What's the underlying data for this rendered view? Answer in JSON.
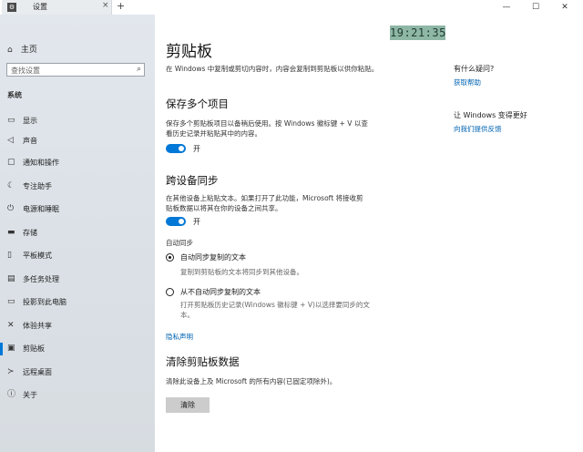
{
  "window": {
    "tab_title": "设置",
    "tab_icon": "settings-app-icon",
    "close_tab": "×",
    "new_tab": "+",
    "minimize": "—",
    "maximize": "☐",
    "close": "✕"
  },
  "clock": "19:21:35",
  "sidebar": {
    "home": "主页",
    "search_placeholder": "查找设置",
    "section": "系统",
    "items": [
      {
        "label": "显示",
        "icon": "display-icon"
      },
      {
        "label": "声音",
        "icon": "sound-icon"
      },
      {
        "label": "通知和操作",
        "icon": "notifications-icon"
      },
      {
        "label": "专注助手",
        "icon": "focus-assist-icon"
      },
      {
        "label": "电源和睡眠",
        "icon": "power-icon"
      },
      {
        "label": "存储",
        "icon": "storage-icon"
      },
      {
        "label": "平板模式",
        "icon": "tablet-mode-icon"
      },
      {
        "label": "多任务处理",
        "icon": "multitasking-icon"
      },
      {
        "label": "投影到此电脑",
        "icon": "project-icon"
      },
      {
        "label": "体验共享",
        "icon": "shared-experiences-icon"
      },
      {
        "label": "剪贴板",
        "icon": "clipboard-icon",
        "active": true
      },
      {
        "label": "远程桌面",
        "icon": "remote-desktop-icon"
      },
      {
        "label": "关于",
        "icon": "about-icon"
      }
    ]
  },
  "main": {
    "title": "剪贴板",
    "intro": "在 Windows 中复制或剪切内容时，内容会复制到剪贴板以供你粘贴。",
    "history": {
      "heading": "保存多个项目",
      "desc_1": "保存多个剪贴板项目以备稍后使用。按 Windows 徽标键 + V 以查",
      "desc_2": "看历史记录并粘贴其中的内容。",
      "toggle_label": "开"
    },
    "sync": {
      "heading": "跨设备同步",
      "desc_1": "在其他设备上粘贴文本。如果打开了此功能，Microsoft 将接收剪",
      "desc_2": "贴板数据以将其在你的设备之间共享。",
      "toggle_label": "开",
      "auto_sync_label": "自动同步",
      "option1_label": "自动同步复制的文本",
      "option1_desc": "复制到剪贴板的文本将同步到其他设备。",
      "option2_label": "从不自动同步复制的文本",
      "option2_desc_1": "打开剪贴板历史记录(Windows 徽标键 + V)以选择要同步的文",
      "option2_desc_2": "本。"
    },
    "privacy_link": "隐私声明",
    "clear": {
      "heading": "清除剪贴板数据",
      "desc": "清除此设备上及 Microsoft 的所有内容(已固定项除外)。",
      "button": "清除"
    }
  },
  "right": {
    "q_heading": "有什么疑问?",
    "q_link": "获取帮助",
    "feedback_heading": "让 Windows 变得更好",
    "feedback_link": "向我们提供反馈"
  }
}
